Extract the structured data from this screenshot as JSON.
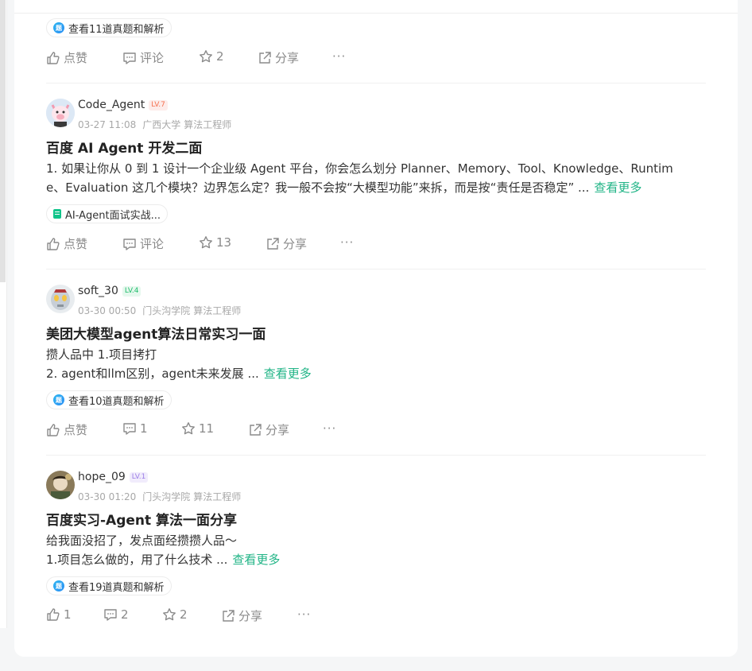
{
  "post0": {
    "tag": "查看11道真题和解析",
    "like": "点赞",
    "comment": "评论",
    "star": "2",
    "share": "分享",
    "more": "···"
  },
  "post1": {
    "user": "Code_Agent",
    "level": "LV.7",
    "date": "03-27 11:08",
    "school": "广西大学",
    "job": "算法工程师",
    "title": "百度 AI Agent 开发二面",
    "body_line1": "1. 如果让你从 0 到 1 设计一个企业级 Agent 平台，你会怎么划分 Planner、Memory、Tool、Knowledge、Runtim",
    "body_line2": "e、Evaluation 这几个模块？边界怎么定？我一般不会按“大模型功能”来拆，而是按“责任是否稳定” ...",
    "read_more": "查看更多",
    "tag": "AI-Agent面试实战...",
    "like": "点赞",
    "comment": "评论",
    "star": "13",
    "share": "分享",
    "more": "···"
  },
  "post2": {
    "user": "soft_30",
    "level": "LV.4",
    "date": "03-30 00:50",
    "school": "门头沟学院",
    "job": "算法工程师",
    "title": "美团大模型agent算法日常实习一面",
    "body_line1": "攒人品中 1.项目拷打",
    "body_line2": "2. agent和llm区别，agent未来发展 ...",
    "read_more": "查看更多",
    "tag": "查看10道真题和解析",
    "like": "点赞",
    "comment": "1",
    "star": "11",
    "share": "分享",
    "more": "···"
  },
  "post3": {
    "user": "hope_09",
    "level": "LV.1",
    "date": "03-30 01:20",
    "school": "门头沟学院",
    "job": "算法工程师",
    "title": "百度实习-Agent 算法一面分享",
    "body_line1": "给我面没招了，发点面经攒攒人品～",
    "body_line2": "1.项目怎么做的，用了什么技术 ...",
    "read_more": "查看更多",
    "tag": "查看19道真题和解析",
    "like": "1",
    "comment": "2",
    "star": "2",
    "share": "分享",
    "more": "···"
  },
  "colors": {
    "accent": "#20b486",
    "lv7": "#f5704f",
    "lv4": "#1fbd6b",
    "lv1": "#9b7de6"
  }
}
